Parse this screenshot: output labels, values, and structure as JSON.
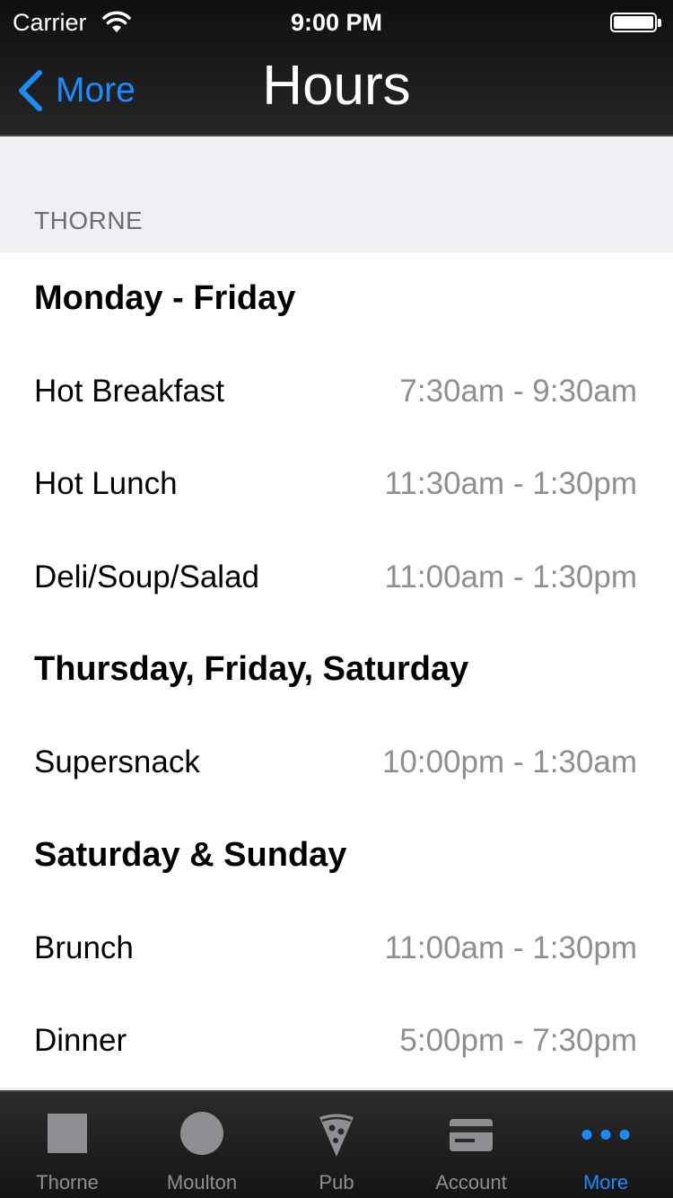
{
  "status_bar": {
    "carrier": "Carrier",
    "time": "9:00 PM"
  },
  "nav": {
    "back_label": "More",
    "title": "Hours"
  },
  "section": {
    "header": "THORNE"
  },
  "rows": [
    {
      "type": "group",
      "label": "Monday - Friday",
      "hours": ""
    },
    {
      "type": "item",
      "label": "Hot Breakfast",
      "hours": "7:30am - 9:30am"
    },
    {
      "type": "item",
      "label": "Hot Lunch",
      "hours": "11:30am - 1:30pm"
    },
    {
      "type": "item",
      "label": "Deli/Soup/Salad",
      "hours": "11:00am - 1:30pm"
    },
    {
      "type": "group",
      "label": "Thursday, Friday, Saturday",
      "hours": ""
    },
    {
      "type": "item",
      "label": "Supersnack",
      "hours": "10:00pm - 1:30am"
    },
    {
      "type": "group",
      "label": "Saturday & Sunday",
      "hours": ""
    },
    {
      "type": "item",
      "label": "Brunch",
      "hours": "11:00am - 1:30pm"
    },
    {
      "type": "item",
      "label": "Dinner",
      "hours": "5:00pm - 7:30pm"
    }
  ],
  "tabs": [
    {
      "label": "Thorne",
      "icon": "square-icon",
      "active": false
    },
    {
      "label": "Moulton",
      "icon": "circle-icon",
      "active": false
    },
    {
      "label": "Pub",
      "icon": "pizza-icon",
      "active": false
    },
    {
      "label": "Account",
      "icon": "card-icon",
      "active": false
    },
    {
      "label": "More",
      "icon": "more-dots-icon",
      "active": true
    }
  ],
  "colors": {
    "accent": "#1a8cff",
    "secondary_text": "#8e8e93",
    "group_bg": "#efeff4"
  }
}
